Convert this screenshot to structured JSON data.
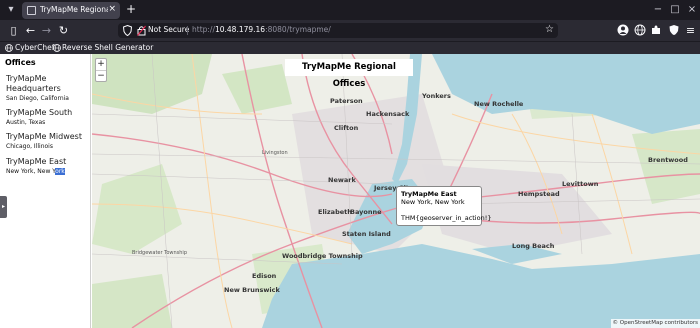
{
  "browser": {
    "tab_title": "TryMapMe Regional Offi",
    "new_tab_label": "+",
    "not_secure": "Not Secure",
    "url_prefix": "http://",
    "url_host": "10.48.179.16",
    "url_path": ":8080/trymapme/",
    "bookmarks": [
      "CyberChef",
      "Reverse Shell Generator"
    ]
  },
  "sidebar": {
    "title": "Offices",
    "offices": [
      {
        "name": "TryMapMe Headquarters",
        "location": "San Diego, California"
      },
      {
        "name": "TryMapMe South",
        "location": "Austin, Texas"
      },
      {
        "name": "TryMapMe Midwest",
        "location": "Chicago, Illinois"
      },
      {
        "name": "TryMapMe East",
        "location_plain": "New York, New Y",
        "location_selected": "ork"
      }
    ]
  },
  "map": {
    "title": "TryMapMe Regional Offices",
    "zoom_in": "+",
    "zoom_out": "−",
    "popup": {
      "name": "TryMapMe East",
      "location": "New York, New York",
      "flag": "THM{geoserver_in_action!}"
    },
    "attribution": "© OpenStreetMap contributors",
    "place_labels": [
      "Paterson",
      "Hackensack",
      "Yonkers",
      "New Rochelle",
      "Clifton",
      "Newark",
      "Jersey City",
      "Elizabeth",
      "Bayonne",
      "Hempstead",
      "Levittown",
      "Brentwood",
      "Woodbridge Township",
      "Edison",
      "New Brunswick",
      "Staten Island",
      "Long Beach",
      "Livingston",
      "Bridgewater Township"
    ]
  }
}
